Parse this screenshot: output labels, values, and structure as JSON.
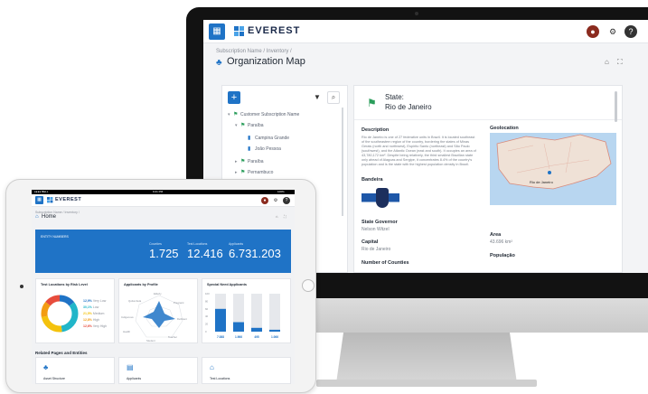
{
  "brand": {
    "name": "EVEREST",
    "accent": "#1f73c6",
    "success": "#2a9d5b"
  },
  "desktop": {
    "breadcrumb": "Subscription Name / Inventory /",
    "page_title": "Organization Map",
    "tree": [
      {
        "label": "Customer Subscription Name",
        "icon": "flag-icon"
      },
      {
        "label": "Paraíba",
        "icon": "flag-icon"
      },
      {
        "label": "Campina Grande",
        "icon": "building-icon"
      },
      {
        "label": "João Pessoa",
        "icon": "building-icon"
      },
      {
        "label": "Paraíba",
        "icon": "flag-icon"
      },
      {
        "label": "Pernambuco",
        "icon": "flag-icon"
      }
    ],
    "detail": {
      "state_label": "State:",
      "state_value": "Rio de Janeiro",
      "description_title": "Description",
      "description_text": "Rio de Janeiro is one of 27 federative units in Brazil. It is located southeast of the southeastern region of the country, bordering the states of Minas Gerais (north and northwest), Espírito Santo (northeast) and São Paulo (southwest), and the Atlantic Ocean (east and south). It occupies an area of 43,780,172 km². Despite being relatively, the third smallest Brazilian state only ahead of Alagoas and Sergipe, it concentrates 8.4% of the country's population and is the state with the highest population density in Brazil.",
      "geolocation_title": "Geolocation",
      "flag_title": "Bandeira",
      "governor_title": "State Governor",
      "governor_value": "Nelson Witzel",
      "capital_title": "Capital",
      "capital_value": "Rio de Janeiro",
      "counties_title": "Number of Counties",
      "area_title": "Area",
      "area_value": "43.696 km²",
      "population_title": "População",
      "map_label": "Rio de Janeiro"
    }
  },
  "tablet": {
    "status_time": "9:21 PM",
    "status_left": "●●●● BELL",
    "status_right": "100%",
    "breadcrumb": "Subscription Name / Inventory /",
    "page_title": "Home",
    "banner_label": "ENTITY NUMBERS",
    "stats": [
      {
        "label": "Counties",
        "value": "1.725"
      },
      {
        "label": "Test Locations",
        "value": "12.416"
      },
      {
        "label": "Applicants",
        "value": "6.731.203"
      }
    ],
    "donut": {
      "title": "Test Locations by Risk Level",
      "items": [
        {
          "value": "12,9%",
          "label": "Very Low",
          "color": "#1f73c6"
        },
        {
          "value": "30,1%",
          "label": "Low",
          "color": "#21b6c9"
        },
        {
          "value": "21,5%",
          "label": "Medium",
          "color": "#f4c20d"
        },
        {
          "value": "12,8%",
          "label": "High",
          "color": "#f39c12"
        },
        {
          "value": "12,6%",
          "label": "Very High",
          "color": "#e74c3c"
        }
      ]
    },
    "radar": {
      "title": "Applicants by Profile",
      "labels": [
        "Elderly",
        "Pregnant",
        "Deficient",
        "Teacher",
        "Student",
        "Health",
        "Indigenous",
        "Quilombola"
      ]
    },
    "bars": {
      "title": "Special Need Applicants",
      "y_ticks": [
        "100",
        "80",
        "60",
        "40",
        "20",
        "0"
      ],
      "values": [
        60,
        25,
        10,
        5
      ],
      "labels": [
        "7.088",
        "1.966",
        "495",
        "1.066"
      ]
    },
    "related_title": "Related Pages and Entities",
    "related": [
      {
        "label": "Asset Structure",
        "icon": "hierarchy-icon"
      },
      {
        "label": "Applicants",
        "icon": "id-card-icon"
      },
      {
        "label": "Test Locations",
        "icon": "school-icon"
      }
    ]
  }
}
